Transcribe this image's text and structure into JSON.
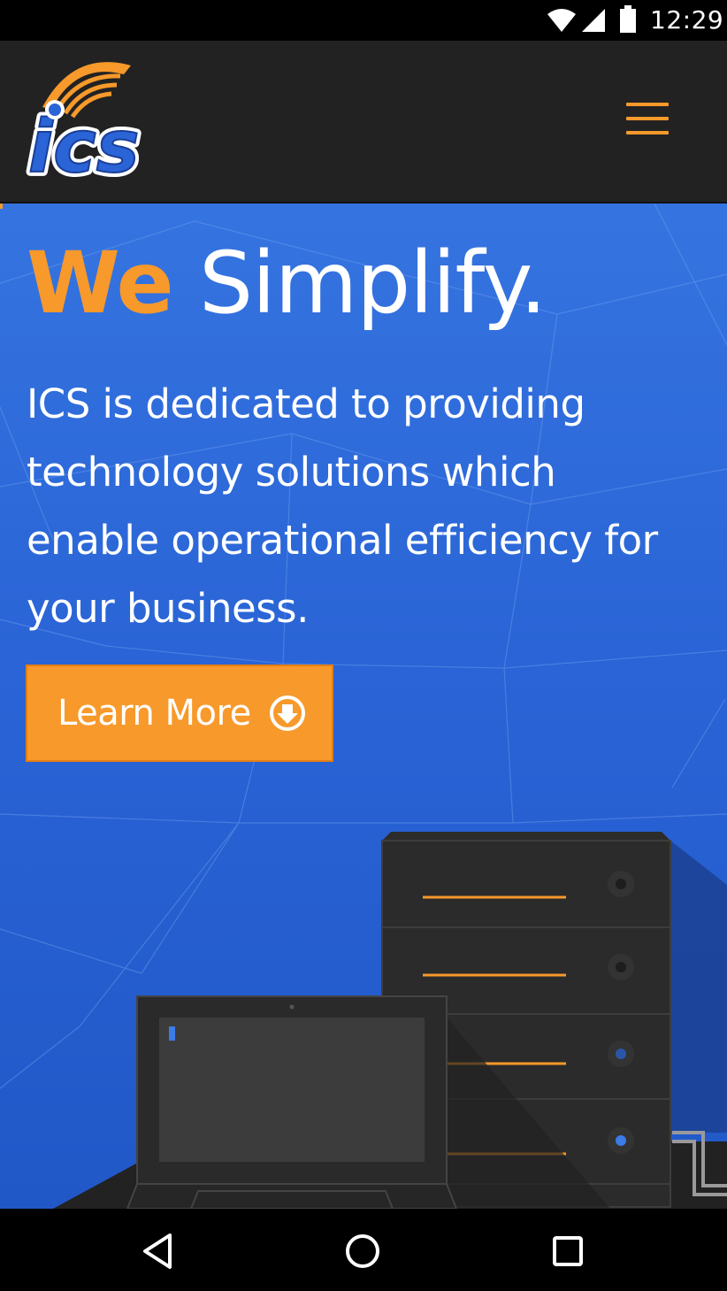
{
  "status_bar": {
    "time": "12:29",
    "icons": [
      "wifi-icon",
      "cell-signal-icon",
      "battery-icon"
    ]
  },
  "header": {
    "logo_text": "ics",
    "menu_icon": "hamburger-menu-icon"
  },
  "hero": {
    "headline_accent": "We",
    "headline_rest": " Simplify.",
    "description": "ICS is dedicated to providing technology solutions which enable operational efficiency for your business.",
    "cta_label": "Learn More",
    "cta_icon": "arrow-down-circle-icon"
  },
  "nav_bar": {
    "icons": [
      "back-icon",
      "home-icon",
      "recent-apps-icon"
    ]
  },
  "colors": {
    "accent": "#f7992b",
    "header_bg": "#222222",
    "hero_blue": "#2a64d6",
    "text": "#ffffff"
  }
}
